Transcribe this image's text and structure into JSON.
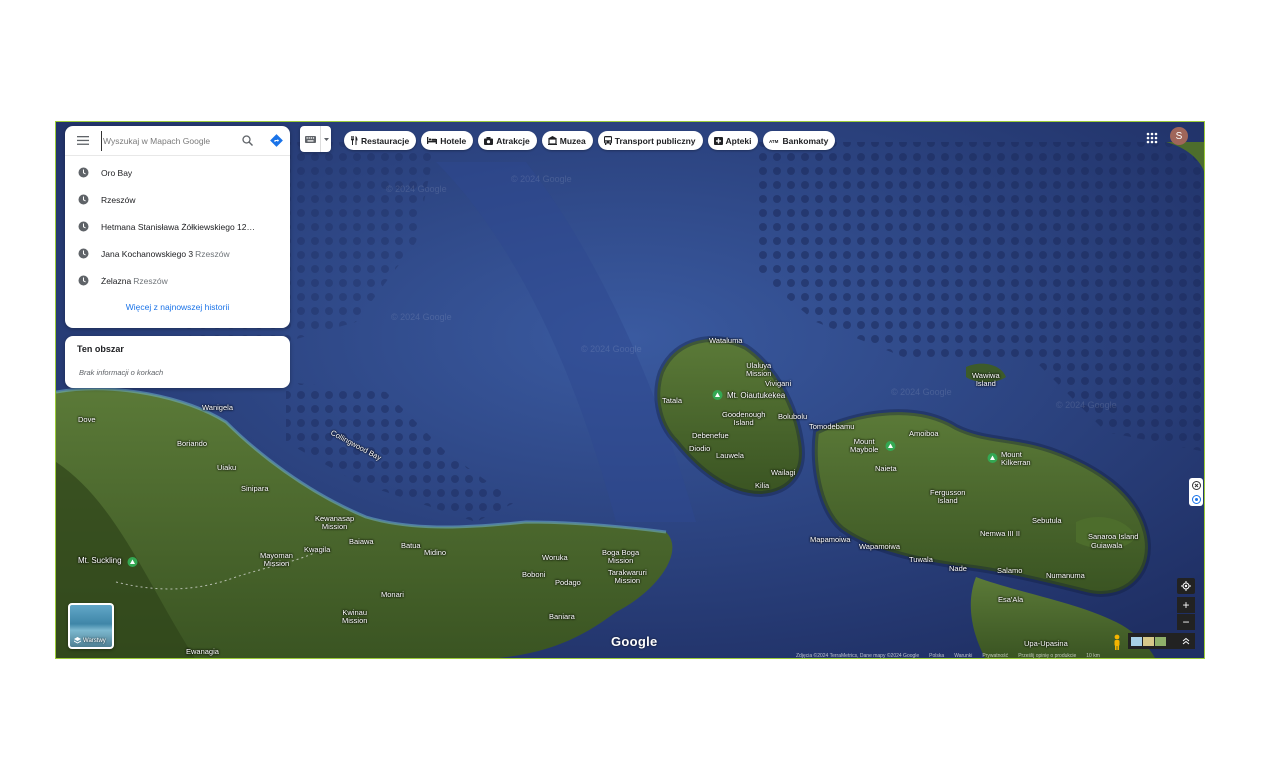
{
  "search": {
    "placeholder": "Wyszukaj w Mapach Google",
    "history": [
      {
        "main": "Oro Bay",
        "sub": ""
      },
      {
        "main": "Rzeszów",
        "sub": ""
      },
      {
        "main": "Hetmana Stanisława Żółkiewskiego 12",
        "sub": "R..."
      },
      {
        "main": "Jana Kochanowskiego 3",
        "sub": "Rzeszów"
      },
      {
        "main": "Żelazna",
        "sub": "Rzeszów"
      }
    ],
    "more_history": "Więcej z najnowszej historii"
  },
  "area": {
    "title": "Ten obszar",
    "traffic_info": "Brak informacji o korkach"
  },
  "chips": [
    {
      "label": "Restauracje",
      "icon": "fork-knife-icon"
    },
    {
      "label": "Hotele",
      "icon": "bed-icon"
    },
    {
      "label": "Atrakcje",
      "icon": "camera-icon"
    },
    {
      "label": "Muzea",
      "icon": "museum-icon"
    },
    {
      "label": "Transport publiczny",
      "icon": "bus-icon"
    },
    {
      "label": "Apteki",
      "icon": "pharmacy-icon"
    },
    {
      "label": "Bankomaty",
      "icon": "atm-icon"
    }
  ],
  "account": {
    "initial": "S",
    "color": "#a0665a"
  },
  "layers": {
    "label": "Warstwy"
  },
  "brand": {
    "logo": "Google"
  },
  "places": [
    {
      "name": "Watalumа"
    },
    {
      "name": "Ulaluya\nMission"
    },
    {
      "name": "Vivigani"
    },
    {
      "name": "Mt. Oiautukekea"
    },
    {
      "name": "Tatala"
    },
    {
      "name": "Goodenough\nIsland"
    },
    {
      "name": "Bolubolu"
    },
    {
      "name": "Debenefue"
    },
    {
      "name": "Diodio"
    },
    {
      "name": "Lauwela"
    },
    {
      "name": "Wailagi"
    },
    {
      "name": "Kilia"
    },
    {
      "name": "Tomodebamu"
    },
    {
      "name": "Mount\nMaybole"
    },
    {
      "name": "Amoiboa"
    },
    {
      "name": "Naieta"
    },
    {
      "name": "Mount\nKilkerran"
    },
    {
      "name": "Fergusson\nIsland"
    },
    {
      "name": "Sebutula"
    },
    {
      "name": "Wawiwa\nIsland"
    },
    {
      "name": "Nemwa III II"
    },
    {
      "name": "Sanaroa Island"
    },
    {
      "name": "Guiawala"
    },
    {
      "name": "Mapamoiwa"
    },
    {
      "name": "Wapamoiwa"
    },
    {
      "name": "Tuwala"
    },
    {
      "name": "Nade"
    },
    {
      "name": "Salamo"
    },
    {
      "name": "Numanuma"
    },
    {
      "name": "Esa'Ala"
    },
    {
      "name": "Upa-Upasina"
    },
    {
      "name": "Wanigela"
    },
    {
      "name": "Dove"
    },
    {
      "name": "Boriando"
    },
    {
      "name": "Uiaku"
    },
    {
      "name": "Sinipara"
    },
    {
      "name": "Collingwood Bay"
    },
    {
      "name": "Kewanasap\nMission"
    },
    {
      "name": "Baiawa"
    },
    {
      "name": "Batua"
    },
    {
      "name": "Midino"
    },
    {
      "name": "Kwagila"
    },
    {
      "name": "Mayoman\nMission"
    },
    {
      "name": "Mt. Suckling"
    },
    {
      "name": "Woruka"
    },
    {
      "name": "Boga Boga\nMission"
    },
    {
      "name": "Boboni"
    },
    {
      "name": "Podago"
    },
    {
      "name": "Tarakwaruri\nMission"
    },
    {
      "name": "Monari"
    },
    {
      "name": "Kwinau\nMission"
    },
    {
      "name": "Baniara"
    },
    {
      "name": "Ewanagia"
    }
  ],
  "attribution": [
    "Zdjęcia ©2024 TerraMetrics, Dane mapy ©2024 Google",
    "Polska",
    "Warunki",
    "Prywatność",
    "Prześlij opinię o produkcie",
    "10 km"
  ],
  "colors": {
    "ocean_deep": "#2a3e7a",
    "land_green": "#4b6a2c",
    "accent_blue": "#1a73e8",
    "frame_border": "#9ccc3a"
  }
}
